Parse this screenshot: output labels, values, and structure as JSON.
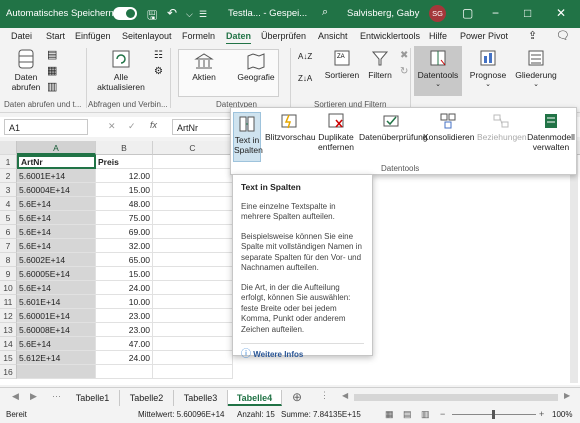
{
  "titlebar": {
    "autosave_label": "Automatisches Speichern",
    "doc_title": "Testla... - Gespei...",
    "user_name": "Salvisberg, Gaby",
    "user_initials": "SG"
  },
  "menubar": [
    "Datei",
    "Start",
    "Einfügen",
    "Seitenlayout",
    "Formeln",
    "Daten",
    "Überprüfen",
    "Ansicht",
    "Entwicklertools",
    "Hilfe",
    "Power Pivot"
  ],
  "ribbon": {
    "daten_abrufen": "Daten abrufen",
    "alle_aktualisieren": "Alle aktualisieren",
    "group1_label": "Daten abrufen und t...",
    "group2_label": "Abfragen und Verbin...",
    "aktien": "Aktien",
    "geografie": "Geografie",
    "group3_label": "Datentypen",
    "sortieren": "Sortieren",
    "filtern": "Filtern",
    "group4_label": "Sortieren und Filtern",
    "datentools": "Datentools",
    "prognose": "Prognose",
    "gliederung": "Gliederung"
  },
  "formula": {
    "name_box": "A1",
    "fx": "fx",
    "content": "ArtNr"
  },
  "columns": [
    "A",
    "B",
    "C"
  ],
  "rows": [
    {
      "n": "1",
      "a": "ArtNr",
      "b": "Preis"
    },
    {
      "n": "2",
      "a": "5.6001E+14",
      "b": "12.00"
    },
    {
      "n": "3",
      "a": "5.60004E+14",
      "b": "15.00"
    },
    {
      "n": "4",
      "a": "5.6E+14",
      "b": "48.00"
    },
    {
      "n": "5",
      "a": "5.6E+14",
      "b": "75.00"
    },
    {
      "n": "6",
      "a": "5.6E+14",
      "b": "69.00"
    },
    {
      "n": "7",
      "a": "5.6E+14",
      "b": "32.00"
    },
    {
      "n": "8",
      "a": "5.6002E+14",
      "b": "65.00"
    },
    {
      "n": "9",
      "a": "5.60005E+14",
      "b": "15.00"
    },
    {
      "n": "10",
      "a": "5.6E+14",
      "b": "24.00"
    },
    {
      "n": "11",
      "a": "5.601E+14",
      "b": "10.00"
    },
    {
      "n": "12",
      "a": "5.60001E+14",
      "b": "23.00"
    },
    {
      "n": "13",
      "a": "5.60008E+14",
      "b": "23.00"
    },
    {
      "n": "14",
      "a": "5.6E+14",
      "b": "47.00"
    },
    {
      "n": "15",
      "a": "5.612E+14",
      "b": "24.00"
    },
    {
      "n": "16",
      "a": "",
      "b": ""
    }
  ],
  "dropdown": {
    "text_in_spalten": "Text in Spalten",
    "blitzvorschau": "Blitzvorschau",
    "duplikate": "Duplikate entfernen",
    "datenueberpruefung": "Datenüberprüfung",
    "konsolidieren": "Konsolidieren",
    "beziehungen": "Beziehungen",
    "datenmodell": "Datenmodell verwalten",
    "group_label": "Datentools"
  },
  "tooltip": {
    "title": "Text in Spalten",
    "p1": "Eine einzelne Textspalte in mehrere Spalten aufteilen.",
    "p2": "Beispielsweise können Sie eine Spalte mit vollständigen Namen in separate Spalten für den Vor- und Nachnamen aufteilen.",
    "p3": "Die Art, in der die Aufteilung erfolgt, können Sie auswählen: feste Breite oder bei jedem Komma, Punkt oder anderem Zeichen aufteilen.",
    "link": "Weitere Infos"
  },
  "sheets": [
    "Tabelle1",
    "Tabelle2",
    "Tabelle3",
    "Tabelle4"
  ],
  "status": {
    "mode": "Bereit",
    "avg": "Mittelwert: 5.60096E+14",
    "count": "Anzahl: 15",
    "sum": "Summe: 7.84135E+15",
    "zoom": "100%"
  }
}
